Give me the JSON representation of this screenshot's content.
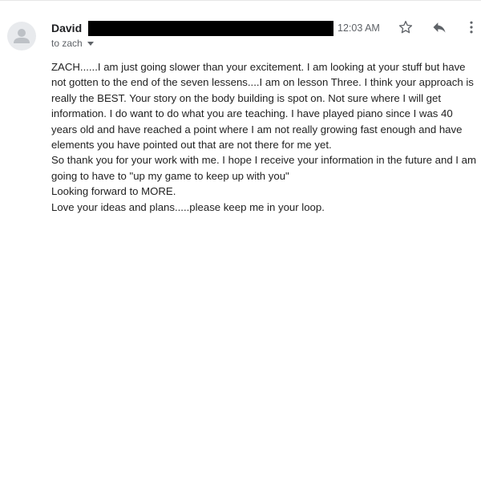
{
  "message": {
    "sender_name": "David",
    "timestamp": "12:03 AM",
    "recipient": "to zach",
    "icons": {
      "avatar": "person-icon",
      "star": "star-outline-icon",
      "reply": "reply-icon",
      "more": "more-vert-icon",
      "recipient_menu": "caret-down-icon"
    },
    "body_paragraphs": [
      "ZACH......I am just going slower than your excitement. I am looking at your stuff but have not gotten to the end of the seven lessens....I am on lesson Three. I think your approach is really the BEST. Your story on the body building is spot on. Not sure where I will get information. I do want to do what you are teaching. I have played piano since I was 40 years old and have reached a point where I am not really growing fast enough and have elements you have pointed out that are not there for me yet.",
      "So thank you for your work with me. I hope I receive your information in the future and I am going to have to \"up my game to keep up with you\"",
      "Looking forward to MORE.",
      "Love your ideas and plans.....please keep me in your loop."
    ]
  },
  "colors": {
    "avatar_bg": "#e8eaed",
    "avatar_fg": "#bdc1c6",
    "icon": "#5f6368",
    "text": "#222222",
    "redaction": "#000000"
  }
}
